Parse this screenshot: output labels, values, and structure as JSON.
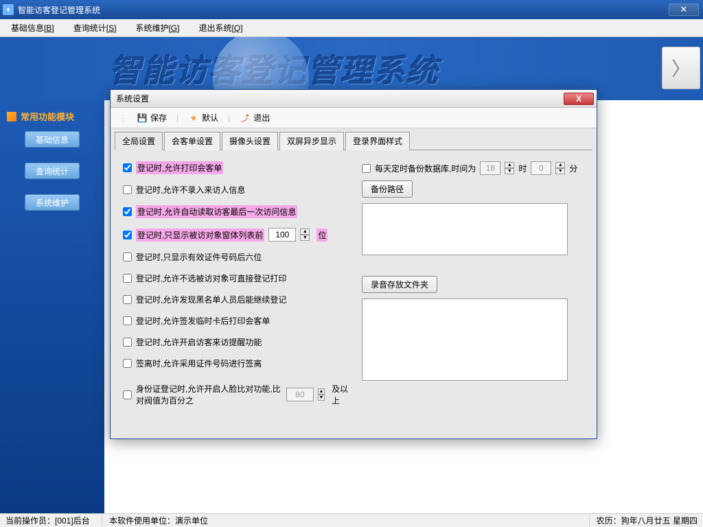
{
  "window": {
    "title": "智能访客登记管理系统"
  },
  "menu": {
    "basic": "基础信息",
    "basic_u": "B",
    "query": "查询统计",
    "query_u": "S",
    "maint": "系统维护",
    "maint_u": "G",
    "exit": "退出系统",
    "exit_u": "Q"
  },
  "banner": {
    "text": "智能访客登记管理系统"
  },
  "sidebar": {
    "header": "常用功能模块",
    "items": [
      "基础信息",
      "查询统计",
      "系统维护"
    ]
  },
  "status": {
    "operator_label": "当前操作员：",
    "operator": "[001]后台",
    "unit_label": "本软件使用单位：",
    "unit": "演示单位",
    "lunar_label": "农历：",
    "lunar": "狗年八月廿五  星期四"
  },
  "dialog": {
    "title": "系统设置",
    "toolbar": {
      "save": "保存",
      "default": "默认",
      "exit": "退出"
    },
    "tabs": [
      "全局设置",
      "会客单设置",
      "摄像头设置",
      "双屏异步显示",
      "登录界面样式"
    ],
    "checks": {
      "c1": "登记时,允许打印会客单",
      "c2": "登记时,允许不录入来访人信息",
      "c3": "登记时,允许自动读取访客最后一次访问信息",
      "c4_pre": "登记时,只显示被访对象窗体列表前",
      "c4_val": "100",
      "c4_post": "位",
      "c5": "登记时,只显示有效证件号码后六位",
      "c6": "登记时,允许不选被访对象可直接登记打印",
      "c7": "登记时,允许发现黑名单人员后能继续登记",
      "c8": "登记时,允许签发临时卡后打印会客单",
      "c9": "登记时,允许开启访客来访提醒功能",
      "c10": "签离时,允许采用证件号码进行签离",
      "c11_pre": "身份证登记时,允许开启人脸比对功能,比对阀值为百分之",
      "c11_val": "80",
      "c11_post": "及以上"
    },
    "right": {
      "daily_backup": "每天定时备份数据库,时间为",
      "hour_val": "18",
      "hour_suffix": "时",
      "min_val": "0",
      "min_suffix": "分",
      "backup_path_btn": "备份路径",
      "record_folder_btn": "录音存放文件夹"
    }
  }
}
